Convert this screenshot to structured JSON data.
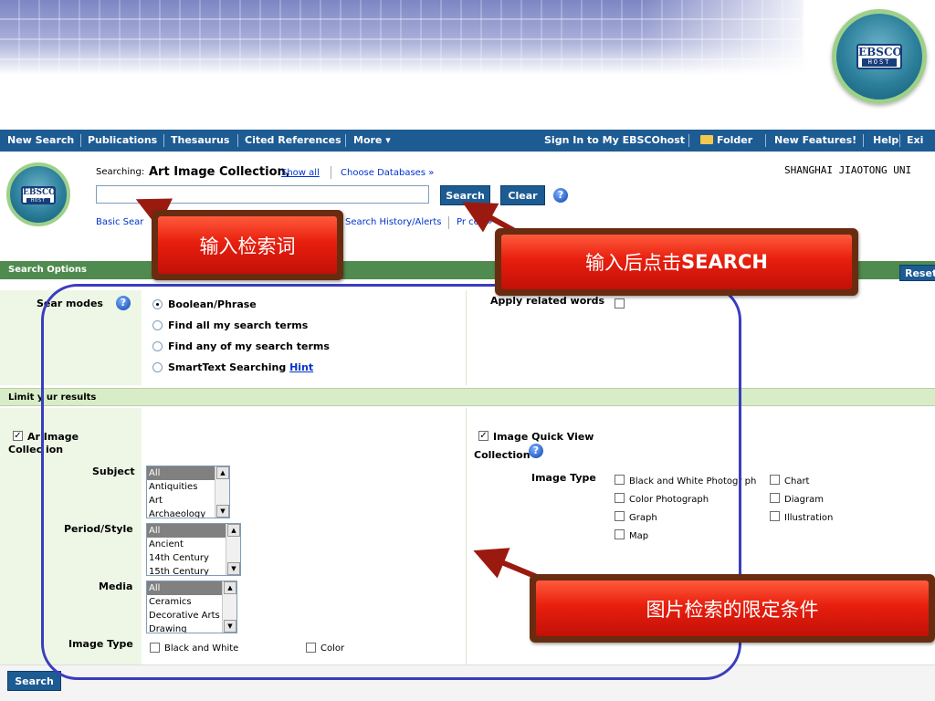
{
  "header": {
    "logo_text": "EBSCO",
    "logo_subtext": "HOST"
  },
  "nav": {
    "left": [
      "New Search",
      "Publications",
      "Thesaurus",
      "Cited References",
      "More ▾"
    ],
    "right": [
      "Sign In to My EBSCOhost",
      "Folder",
      "New Features!",
      "Help",
      "Exi"
    ]
  },
  "search": {
    "searching_label": "Searching:",
    "collection": "Art Image Collection,",
    "show_all": "Show all",
    "choose_databases": "Choose Databases »",
    "institution": "SHANGHAI JIAOTONG UNI",
    "input_value": "",
    "search_button": "Search",
    "clear_button": "Clear",
    "basic_search": "Basic Sear",
    "history": "Search History/Alerts",
    "preferences": "Pr      ces »"
  },
  "options": {
    "title": "Search Options",
    "reset": "Reset",
    "modes_label": "Sear   modes",
    "modes": [
      "Boolean/Phrase",
      "Find all my search terms",
      "Find any of my search terms",
      "SmartText Searching"
    ],
    "selected_mode": "Boolean/Phrase",
    "hint": "Hint",
    "related_words": "Apply related words"
  },
  "limits": {
    "title": "Limit y  ur results",
    "collection_checkbox": "Ar   Image",
    "collection_checkbox_line2": "Collec  ion",
    "subject_label": "Subject",
    "subject_items": [
      "All",
      "Antiquities",
      "Art",
      "Archaeology"
    ],
    "period_label": "Period/Style",
    "period_items": [
      "All",
      "Ancient",
      "14th Century",
      "15th Century"
    ],
    "media_label": "Media",
    "media_items": [
      "All",
      "Ceramics",
      "Decorative Arts",
      "Drawing"
    ],
    "image_type_label": "Image Type",
    "image_type_bw": "Black and White",
    "image_type_color": "Color",
    "iqv_label": "Image Quick View",
    "iqv_label2": "Collection",
    "iqv_image_type": "Image Type",
    "iqv_col1": [
      "Black and White Photogr  ph",
      "Color Photograph",
      "Graph",
      "Map"
    ],
    "iqv_col2": [
      "Chart",
      "Diagram",
      "Illustration"
    ]
  },
  "footer": {
    "search_button": "Search"
  },
  "annotations": {
    "input_hint": "输入检索词",
    "click_hint_cn": "输入后点击",
    "click_hint_en": "SEARCH",
    "limit_hint": "图片检索的限定条件"
  },
  "colors": {
    "nav": "#1d5b93",
    "green_bar": "#4f8a4f",
    "light_green": "#d7ecc7",
    "callout_red": "#e81f0e",
    "frame_blue": "#3a3dbe"
  }
}
